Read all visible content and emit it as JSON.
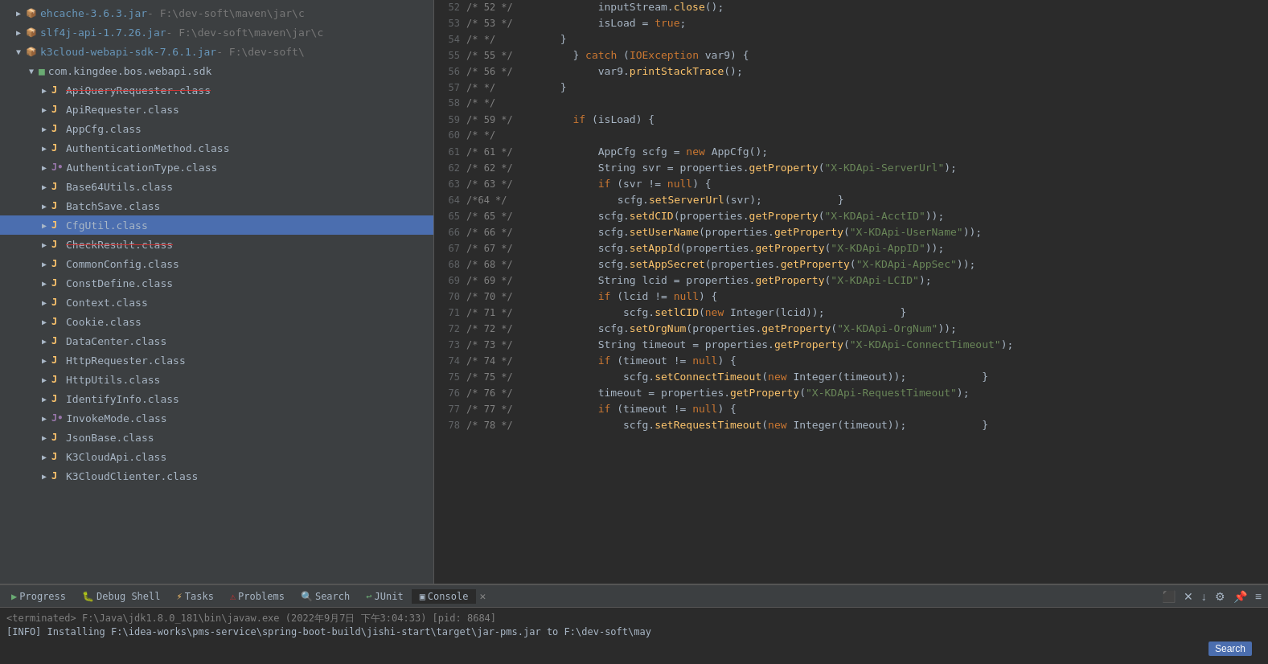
{
  "leftPanel": {
    "items": [
      {
        "id": "ehcache",
        "indent": 1,
        "icon": "jar",
        "text": "ehcache-3.6.3.jar",
        "path": " - F:\\dev-soft\\maven\\jar\\c",
        "strikethrough": false,
        "selected": false
      },
      {
        "id": "slf4j",
        "indent": 1,
        "icon": "jar",
        "text": "slf4j-api-1.7.26.jar",
        "path": " - F:\\dev-soft\\maven\\jar\\c",
        "strikethrough": false,
        "selected": false
      },
      {
        "id": "k3cloud",
        "indent": 1,
        "icon": "jar",
        "text": "k3cloud-webapi-sdk-7.6.1.jar",
        "path": " - F:\\dev-soft\\",
        "strikethrough": false,
        "selected": false,
        "expanded": true
      },
      {
        "id": "com.kingdee",
        "indent": 2,
        "icon": "pkg",
        "text": "com.kingdee.bos.webapi.sdk",
        "strikethrough": false,
        "selected": false,
        "expanded": true
      },
      {
        "id": "ApiQueryRequester",
        "indent": 3,
        "icon": "J",
        "text": "ApiQueryRequester.class",
        "strikethrough": true,
        "selected": false
      },
      {
        "id": "ApiRequester",
        "indent": 3,
        "icon": "J",
        "text": "ApiRequester.class",
        "strikethrough": false,
        "selected": false
      },
      {
        "id": "AppCfg",
        "indent": 3,
        "icon": "J",
        "text": "AppCfg.class",
        "strikethrough": false,
        "selected": false
      },
      {
        "id": "AuthenticationMethod",
        "indent": 3,
        "icon": "J",
        "text": "AuthenticationMethod.class",
        "strikethrough": false,
        "selected": false
      },
      {
        "id": "AuthenticationType",
        "indent": 3,
        "icon": "J-interface",
        "text": "AuthenticationType.class",
        "strikethrough": false,
        "selected": false
      },
      {
        "id": "Base64Utils",
        "indent": 3,
        "icon": "J",
        "text": "Base64Utils.class",
        "strikethrough": false,
        "selected": false
      },
      {
        "id": "BatchSave",
        "indent": 3,
        "icon": "J",
        "text": "BatchSave.class",
        "strikethrough": false,
        "selected": false
      },
      {
        "id": "CfgUtil",
        "indent": 3,
        "icon": "J",
        "text": "CfgUtil.class",
        "strikethrough": false,
        "selected": true
      },
      {
        "id": "CheckResult",
        "indent": 3,
        "icon": "J",
        "text": "CheckResult.class",
        "strikethrough": true,
        "selected": false
      },
      {
        "id": "CommonConfig",
        "indent": 3,
        "icon": "J",
        "text": "CommonConfig.class",
        "strikethrough": false,
        "selected": false
      },
      {
        "id": "ConstDefine",
        "indent": 3,
        "icon": "J",
        "text": "ConstDefine.class",
        "strikethrough": false,
        "selected": false
      },
      {
        "id": "Context",
        "indent": 3,
        "icon": "J",
        "text": "Context.class",
        "strikethrough": false,
        "selected": false
      },
      {
        "id": "Cookie",
        "indent": 3,
        "icon": "J",
        "text": "Cookie.class",
        "strikethrough": false,
        "selected": false
      },
      {
        "id": "DataCenter",
        "indent": 3,
        "icon": "J",
        "text": "DataCenter.class",
        "strikethrough": false,
        "selected": false
      },
      {
        "id": "HttpRequester",
        "indent": 3,
        "icon": "J",
        "text": "HttpRequester.class",
        "strikethrough": false,
        "selected": false
      },
      {
        "id": "HttpUtils",
        "indent": 3,
        "icon": "J",
        "text": "HttpUtils.class",
        "strikethrough": false,
        "selected": false
      },
      {
        "id": "IdentifyInfo",
        "indent": 3,
        "icon": "J",
        "text": "IdentifyInfo.class",
        "strikethrough": false,
        "selected": false
      },
      {
        "id": "InvokeMode",
        "indent": 3,
        "icon": "J-interface",
        "text": "InvokeMode.class",
        "strikethrough": false,
        "selected": false
      },
      {
        "id": "JsonBase",
        "indent": 3,
        "icon": "J",
        "text": "JsonBase.class",
        "strikethrough": false,
        "selected": false
      },
      {
        "id": "K3CloudApi",
        "indent": 3,
        "icon": "J",
        "text": "K3CloudApi.class",
        "strikethrough": false,
        "selected": false
      },
      {
        "id": "K3CloudClienter",
        "indent": 3,
        "icon": "J",
        "text": "K3CloudClienter.class",
        "strikethrough": false,
        "selected": false
      }
    ]
  },
  "codeLines": [
    {
      "outer": "52",
      "inner": "/* 52 */",
      "content": "            inputStream.close();"
    },
    {
      "outer": "53",
      "inner": "/* 53 */",
      "content": "            isLoad = true;"
    },
    {
      "outer": "54",
      "inner": "/*  */",
      "content": "        }"
    },
    {
      "outer": "55",
      "inner": "/* 55 */",
      "content": "        } catch (IOException var9) {"
    },
    {
      "outer": "56",
      "inner": "/* 56 */",
      "content": "            var9.printStackTrace();"
    },
    {
      "outer": "57",
      "inner": "/*  */",
      "content": "        }"
    },
    {
      "outer": "58",
      "inner": "/*  */",
      "content": ""
    },
    {
      "outer": "59",
      "inner": "/* 59 */",
      "content": "        if (isLoad) {"
    },
    {
      "outer": "60",
      "inner": "/*  */",
      "content": ""
    },
    {
      "outer": "61",
      "inner": "/* 61 */",
      "content": "            AppCfg scfg = new AppCfg();"
    },
    {
      "outer": "62",
      "inner": "/* 62 */",
      "content": "            String svr = properties.getProperty(\"X-KDApi-ServerUrl\");"
    },
    {
      "outer": "63",
      "inner": "/* 63 */",
      "content": "            if (svr != null) {"
    },
    {
      "outer": "64",
      "inner": "/*64 */",
      "content": "                scfg.setServerUrl(svr);            }"
    },
    {
      "outer": "65",
      "inner": "/* 65 */",
      "content": "            scfg.setdCID(properties.getProperty(\"X-KDApi-AcctID\"));"
    },
    {
      "outer": "66",
      "inner": "/* 66 */",
      "content": "            scfg.setUserName(properties.getProperty(\"X-KDApi-UserName\"));"
    },
    {
      "outer": "67",
      "inner": "/* 67 */",
      "content": "            scfg.setAppId(properties.getProperty(\"X-KDApi-AppID\"));"
    },
    {
      "outer": "68",
      "inner": "/* 68 */",
      "content": "            scfg.setAppSecret(properties.getProperty(\"X-KDApi-AppSec\"));"
    },
    {
      "outer": "69",
      "inner": "/* 69 */",
      "content": "            String lcid = properties.getProperty(\"X-KDApi-LCID\");"
    },
    {
      "outer": "70",
      "inner": "/* 70 */",
      "content": "            if (lcid != null) {"
    },
    {
      "outer": "71",
      "inner": "/* 71 */",
      "content": "                scfg.setlCID(new Integer(lcid));            }"
    },
    {
      "outer": "72",
      "inner": "/* 72 */",
      "content": "            scfg.setOrgNum(properties.getProperty(\"X-KDApi-OrgNum\"));"
    },
    {
      "outer": "73",
      "inner": "/* 73 */",
      "content": "            String timeout = properties.getProperty(\"X-KDApi-ConnectTimeout\");"
    },
    {
      "outer": "74",
      "inner": "/* 74 */",
      "content": "            if (timeout != null) {"
    },
    {
      "outer": "75",
      "inner": "/* 75 */",
      "content": "                scfg.setConnectTimeout(new Integer(timeout));            }"
    },
    {
      "outer": "76",
      "inner": "/* 76 */",
      "content": "            timeout = properties.getProperty(\"X-KDApi-RequestTimeout\");"
    },
    {
      "outer": "77",
      "inner": "/* 77 */",
      "content": "            if (timeout != null) {"
    },
    {
      "outer": "78",
      "inner": "/* 78 */",
      "content": "                scfg.setRequestTimeout(new Integer(timeout));            }"
    }
  ],
  "bottomPanel": {
    "tabs": [
      {
        "id": "progress",
        "label": "Progress",
        "icon": "progress",
        "active": false
      },
      {
        "id": "debug",
        "label": "Debug Shell",
        "icon": "debug",
        "active": false
      },
      {
        "id": "tasks",
        "label": "Tasks",
        "icon": "tasks",
        "active": false
      },
      {
        "id": "problems",
        "label": "Problems",
        "icon": "problems",
        "active": false
      },
      {
        "id": "search",
        "label": "Search",
        "icon": "search",
        "active": false
      },
      {
        "id": "junit",
        "label": "JUnit",
        "icon": "junit",
        "active": false
      },
      {
        "id": "console",
        "label": "Console",
        "icon": "console",
        "active": true
      }
    ],
    "console": {
      "terminated": "<terminated> F:\\Java\\jdk1.8.0_181\\bin\\javaw.exe (2022年9月7日 下午3:04:33) [pid: 8684]",
      "line1": "[INFO] Installing F:\\idea-works\\pms-service\\spring-boot-build\\jishi-start\\target\\jar-pms.jar to F:\\dev-soft\\may"
    },
    "searchButton": "Search"
  }
}
